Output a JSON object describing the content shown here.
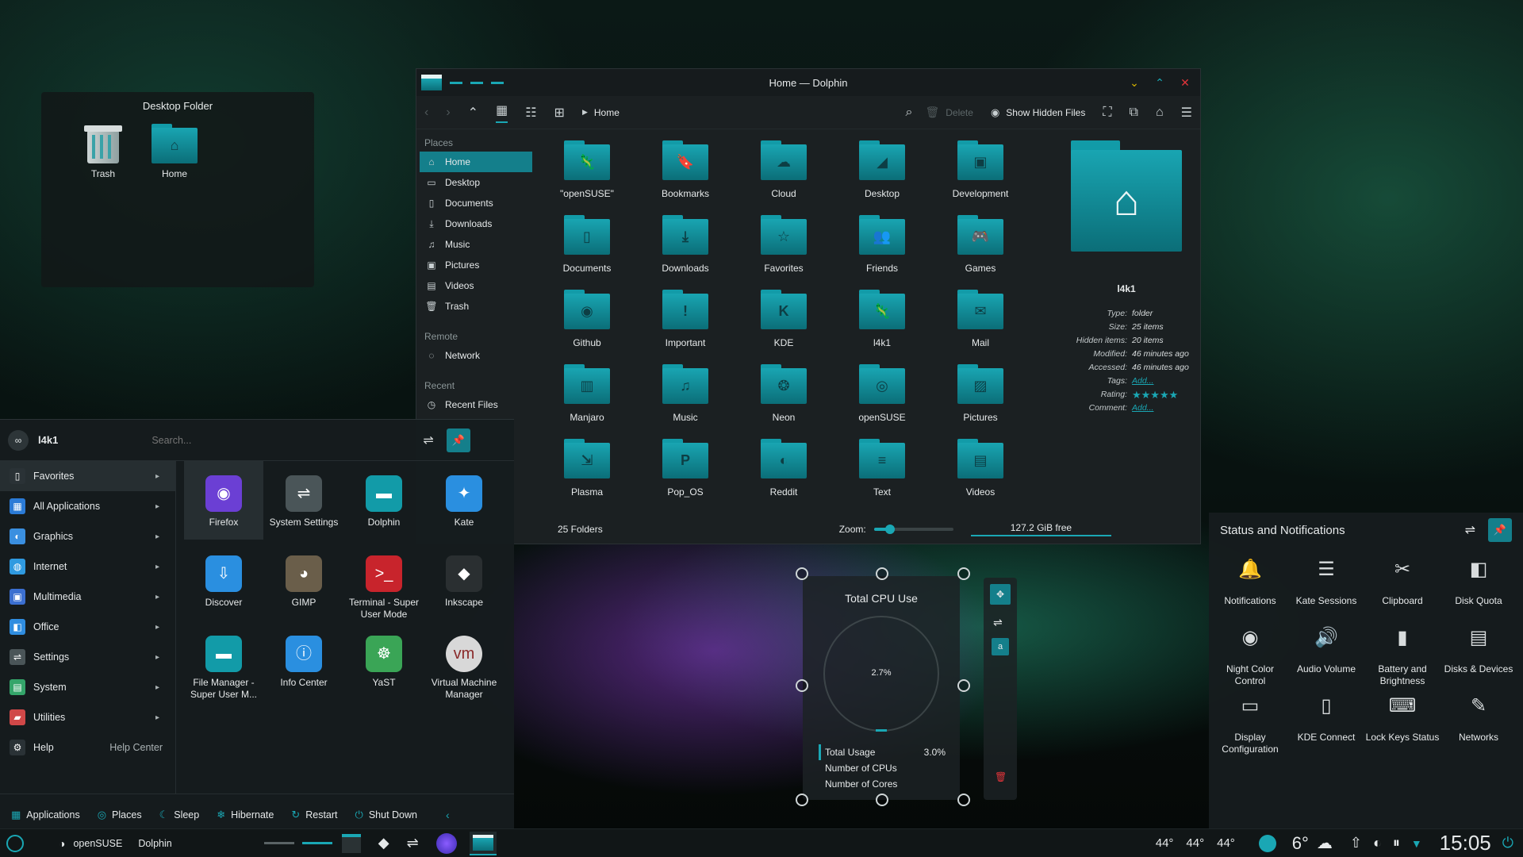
{
  "desktop_folder": {
    "title": "Desktop Folder",
    "items": [
      {
        "label": "Trash",
        "icon": "trash-icon"
      },
      {
        "label": "Home",
        "icon": "home-folder-icon"
      }
    ]
  },
  "dolphin": {
    "title": "Home — Dolphin",
    "breadcrumb": "Home",
    "toolbar": {
      "delete_label": "Delete",
      "hidden_files_label": "Show Hidden Files"
    },
    "places_header": "Places",
    "places": [
      "Home",
      "Desktop",
      "Documents",
      "Downloads",
      "Music",
      "Pictures",
      "Videos",
      "Trash"
    ],
    "remote_header": "Remote",
    "remote": [
      "Network"
    ],
    "recent_header": "Recent",
    "recent": [
      "Recent Files"
    ],
    "folders": [
      "\"openSUSE\"",
      "Bookmarks",
      "Cloud",
      "Desktop",
      "Development",
      "Documents",
      "Downloads",
      "Favorites",
      "Friends",
      "Games",
      "Github",
      "Important",
      "KDE",
      "l4k1",
      "Mail",
      "Manjaro",
      "Music",
      "Neon",
      "openSUSE",
      "Pictures",
      "Plasma",
      "Pop_OS",
      "Reddit",
      "Text",
      "Videos"
    ],
    "info": {
      "name": "l4k1",
      "rows": [
        {
          "k": "Type:",
          "v": "folder"
        },
        {
          "k": "Size:",
          "v": "25 items"
        },
        {
          "k": "Hidden items:",
          "v": "20 items"
        },
        {
          "k": "Modified:",
          "v": "46 minutes ago"
        },
        {
          "k": "Accessed:",
          "v": "46 minutes ago"
        },
        {
          "k": "Tags:",
          "v": "Add..."
        },
        {
          "k": "Rating:",
          "v": "★★★★★"
        },
        {
          "k": "Comment:",
          "v": "Add..."
        }
      ]
    },
    "status": {
      "count": "25 Folders",
      "zoom_label": "Zoom:",
      "zoom_level": 0.2,
      "free": "127.2 GiB free"
    }
  },
  "launcher": {
    "user": "l4k1",
    "search_placeholder": "Search...",
    "categories": [
      {
        "label": "Favorites",
        "color": "#2a3236"
      },
      {
        "label": "All Applications",
        "color": "#2b7bd6"
      },
      {
        "label": "Graphics",
        "color": "#3a8fe0"
      },
      {
        "label": "Internet",
        "color": "#2f9ae0"
      },
      {
        "label": "Multimedia",
        "color": "#3b6fd0"
      },
      {
        "label": "Office",
        "color": "#2f8de0"
      },
      {
        "label": "Settings",
        "color": "#4a5558"
      },
      {
        "label": "System",
        "color": "#34a56a"
      },
      {
        "label": "Utilities",
        "color": "#d04848"
      },
      {
        "label": "Help",
        "color": "#2a3236"
      }
    ],
    "help_center": "Help Center",
    "apps": [
      {
        "label": "Firefox",
        "color": "#6b3fd4"
      },
      {
        "label": "System Settings",
        "color": "#4a5558"
      },
      {
        "label": "Dolphin",
        "color": "#129ba8"
      },
      {
        "label": "Kate",
        "color": "#2a8fe0"
      },
      {
        "label": "Discover",
        "color": "#2a8fe0"
      },
      {
        "label": "GIMP",
        "color": "#6a5e4a"
      },
      {
        "label": "Terminal - Super User Mode",
        "color": "#c8242c"
      },
      {
        "label": "Inkscape",
        "color": "#2a2f31"
      },
      {
        "label": "File Manager - Super User M...",
        "color": "#129ba8"
      },
      {
        "label": "Info Center",
        "color": "#2a8fe0"
      },
      {
        "label": "YaST",
        "color": "#3aa556"
      },
      {
        "label": "Virtual Machine Manager",
        "color": "#d8d8d8"
      }
    ],
    "bottom": [
      "Applications",
      "Places",
      "Sleep",
      "Hibernate",
      "Restart",
      "Shut Down"
    ]
  },
  "cpu_widget": {
    "title": "Total CPU Use",
    "value": "2.7%",
    "rows": [
      {
        "label": "Total Usage",
        "value": "3.0%"
      },
      {
        "label": "Number of CPUs",
        "value": ""
      },
      {
        "label": "Number of Cores",
        "value": ""
      }
    ]
  },
  "status_panel": {
    "title": "Status and Notifications",
    "items": [
      {
        "label": "Notifications",
        "icon": "bell-icon",
        "glyph": "🔔"
      },
      {
        "label": "Kate Sessions",
        "icon": "kate-sessions-icon",
        "glyph": "☰"
      },
      {
        "label": "Clipboard",
        "icon": "clipboard-icon",
        "glyph": "✂"
      },
      {
        "label": "Disk Quota",
        "icon": "disk-quota-icon",
        "glyph": "◧"
      },
      {
        "label": "Night Color Control",
        "icon": "night-color-icon",
        "glyph": "◉"
      },
      {
        "label": "Audio Volume",
        "icon": "volume-icon",
        "glyph": "🔊"
      },
      {
        "label": "Battery and Brightness",
        "icon": "battery-icon",
        "glyph": "▮"
      },
      {
        "label": "Disks & Devices",
        "icon": "disks-icon",
        "glyph": "▤"
      },
      {
        "label": "Display Configuration",
        "icon": "display-icon",
        "glyph": "▭"
      },
      {
        "label": "KDE Connect",
        "icon": "kde-connect-icon",
        "glyph": "▯"
      },
      {
        "label": "Lock Keys Status",
        "icon": "keyboard-icon",
        "glyph": "⌨"
      },
      {
        "label": "Networks",
        "icon": "network-icon",
        "glyph": "✎"
      }
    ]
  },
  "taskbar": {
    "left": [
      "openSUSE",
      "Dolphin"
    ],
    "temps": [
      "44°",
      "44°",
      "44°"
    ],
    "weather": "6°",
    "clock": "15:05"
  },
  "colors": {
    "accent": "#1aa7b4",
    "close": "#e0343a",
    "minimize": "#d6b400"
  }
}
